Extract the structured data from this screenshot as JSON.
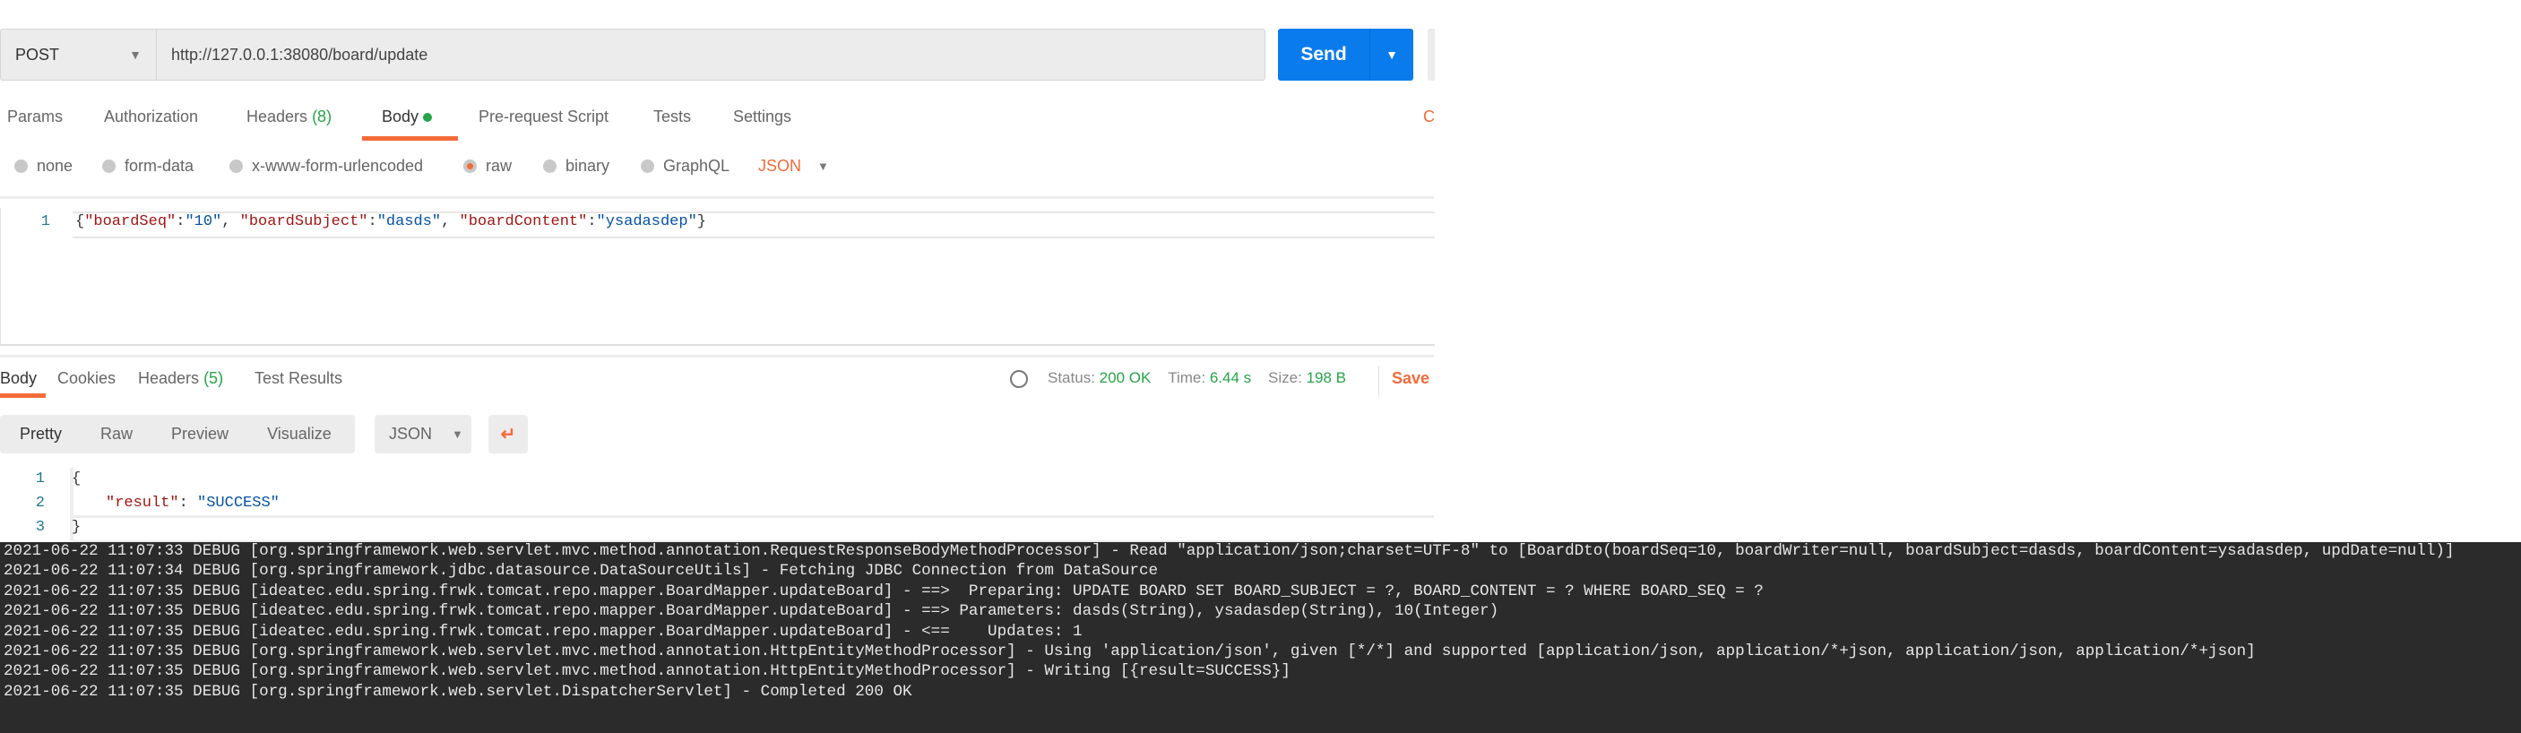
{
  "request": {
    "method": "POST",
    "url": "http://127.0.0.1:38080/board/update",
    "send_label": "Send"
  },
  "request_tabs": {
    "params": "Params",
    "authorization": "Authorization",
    "headers": "Headers",
    "headers_count": "(8)",
    "body": "Body",
    "prerequest": "Pre-request Script",
    "tests": "Tests",
    "settings": "Settings",
    "cookies_cut": "C"
  },
  "body_types": {
    "none": "none",
    "form_data": "form-data",
    "urlencoded": "x-www-form-urlencoded",
    "raw": "raw",
    "binary": "binary",
    "graphql": "GraphQL",
    "format": "JSON",
    "selected": "raw"
  },
  "request_body": {
    "line_no": "1",
    "open": "{",
    "k1": "\"boardSeq\"",
    "v1": "\"10\"",
    "k2": "\"boardSubject\"",
    "v2": "\"dasds\"",
    "k3": "\"boardContent\"",
    "v3": "\"ysadasdep\"",
    "close": "}",
    "colon": ":",
    "comma": ", "
  },
  "response_tabs": {
    "body": "Body",
    "cookies": "Cookies",
    "headers": "Headers",
    "headers_count": "(5)",
    "test_results": "Test Results"
  },
  "response_meta": {
    "status_label": "Status:",
    "status": "200 OK",
    "time_label": "Time:",
    "time": "6.44 s",
    "size_label": "Size:",
    "size": "198 B",
    "save": "Save"
  },
  "response_view": {
    "pretty": "Pretty",
    "raw": "Raw",
    "preview": "Preview",
    "visualize": "Visualize",
    "format": "JSON"
  },
  "response_body": {
    "lines": [
      "1",
      "2",
      "3"
    ],
    "open": "{",
    "key": "\"result\"",
    "colon": ": ",
    "value": "\"SUCCESS\"",
    "close": "}"
  },
  "colors": {
    "accent": "#f26b3a",
    "send": "#097bed",
    "success": "#26a449",
    "console_bg": "#2b2b2b"
  },
  "console": [
    "2021-06-22 11:07:33 DEBUG [org.springframework.web.servlet.mvc.method.annotation.RequestResponseBodyMethodProcessor] - Read \"application/json;charset=UTF-8\" to [BoardDto(boardSeq=10, boardWriter=null, boardSubject=dasds, boardContent=ysadasdep, updDate=null)]",
    "2021-06-22 11:07:34 DEBUG [org.springframework.jdbc.datasource.DataSourceUtils] - Fetching JDBC Connection from DataSource",
    "2021-06-22 11:07:35 DEBUG [ideatec.edu.spring.frwk.tomcat.repo.mapper.BoardMapper.updateBoard] - ==>  Preparing: UPDATE BOARD SET BOARD_SUBJECT = ?, BOARD_CONTENT = ? WHERE BOARD_SEQ = ?",
    "2021-06-22 11:07:35 DEBUG [ideatec.edu.spring.frwk.tomcat.repo.mapper.BoardMapper.updateBoard] - ==> Parameters: dasds(String), ysadasdep(String), 10(Integer)",
    "2021-06-22 11:07:35 DEBUG [ideatec.edu.spring.frwk.tomcat.repo.mapper.BoardMapper.updateBoard] - <==    Updates: 1",
    "2021-06-22 11:07:35 DEBUG [org.springframework.web.servlet.mvc.method.annotation.HttpEntityMethodProcessor] - Using 'application/json', given [*/*] and supported [application/json, application/*+json, application/json, application/*+json]",
    "2021-06-22 11:07:35 DEBUG [org.springframework.web.servlet.mvc.method.annotation.HttpEntityMethodProcessor] - Writing [{result=SUCCESS}]",
    "2021-06-22 11:07:35 DEBUG [org.springframework.web.servlet.DispatcherServlet] - Completed 200 OK"
  ]
}
